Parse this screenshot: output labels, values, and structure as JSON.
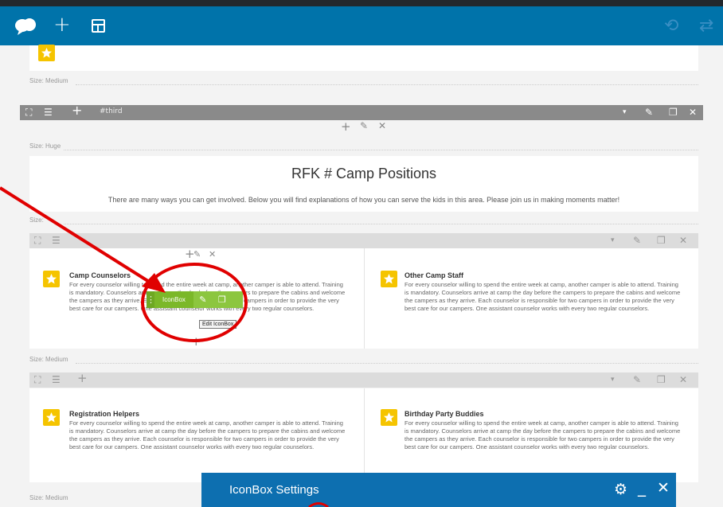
{
  "nav": {
    "plus_glyph": "+",
    "undo_glyph": "⟲",
    "redo_glyph": "⇄"
  },
  "sizes": {
    "medium": "Medium",
    "huge": "Huge",
    "prefix": "Size:"
  },
  "row_third": {
    "name": "#third",
    "plus": "+",
    "caret": "▾",
    "edit": "✎",
    "clone": "❐",
    "close": "✕"
  },
  "section_controls": {
    "plus": "+",
    "edit": "✎",
    "close": "✕"
  },
  "heading": {
    "title": "RFK # Camp Positions",
    "subtitle": "There are many ways you can get involved. Below you will find explanations of how you can serve the kids in this area. Please join us in making moments matter!"
  },
  "iconboxes": [
    {
      "title": "Camp Counselors",
      "text": "For every counselor willing to spend the entire week at camp, another camper is able to attend. Training is mandatory. Counselors arrive at camp the day before the campers to prepare the cabins and welcome the campers as they arrive. Each counselor is responsible for two campers in order to provide the very best care for our campers. One assistant counselor works with every two regular counselors."
    },
    {
      "title": "Other Camp Staff",
      "text": "For every counselor willing to spend the entire week at camp, another camper is able to attend. Training is mandatory. Counselors arrive at camp the day before the campers to prepare the cabins and welcome the campers as they arrive. Each counselor is responsible for two campers in order to provide the very best care for our campers. One assistant counselor works with every two regular counselors."
    },
    {
      "title": "Registration Helpers",
      "text": "For every counselor willing to spend the entire week at camp, another camper is able to attend. Training is mandatory. Counselors arrive at camp the day before the campers to prepare the cabins and welcome the campers as they arrive. Each counselor is responsible for two campers in order to provide the very best care for our campers. One assistant counselor works with every two regular counselors."
    },
    {
      "title": "Birthday Party Buddies",
      "text": "For every counselor willing to spend the entire week at camp, another camper is able to attend. Training is mandatory. Counselors arrive at camp the day before the campers to prepare the cabins and welcome the campers as they arrive. Each counselor is responsible for two campers in order to provide the very best care for our campers. One assistant counselor works with every two regular counselors."
    }
  ],
  "iconbox_toolbar": {
    "label": "IconBox",
    "edit": "✎",
    "clone": "❐",
    "tooltip": "Edit IconBox"
  },
  "settings": {
    "title": "IconBox Settings",
    "gear": "⚙",
    "minimize": "_",
    "close": "✕"
  },
  "colors": {
    "nav_bg": "#0073aa",
    "icon_yellow": "#f5c400",
    "toolbar_green": "#8cc63f",
    "annotation_red": "#e00000"
  }
}
